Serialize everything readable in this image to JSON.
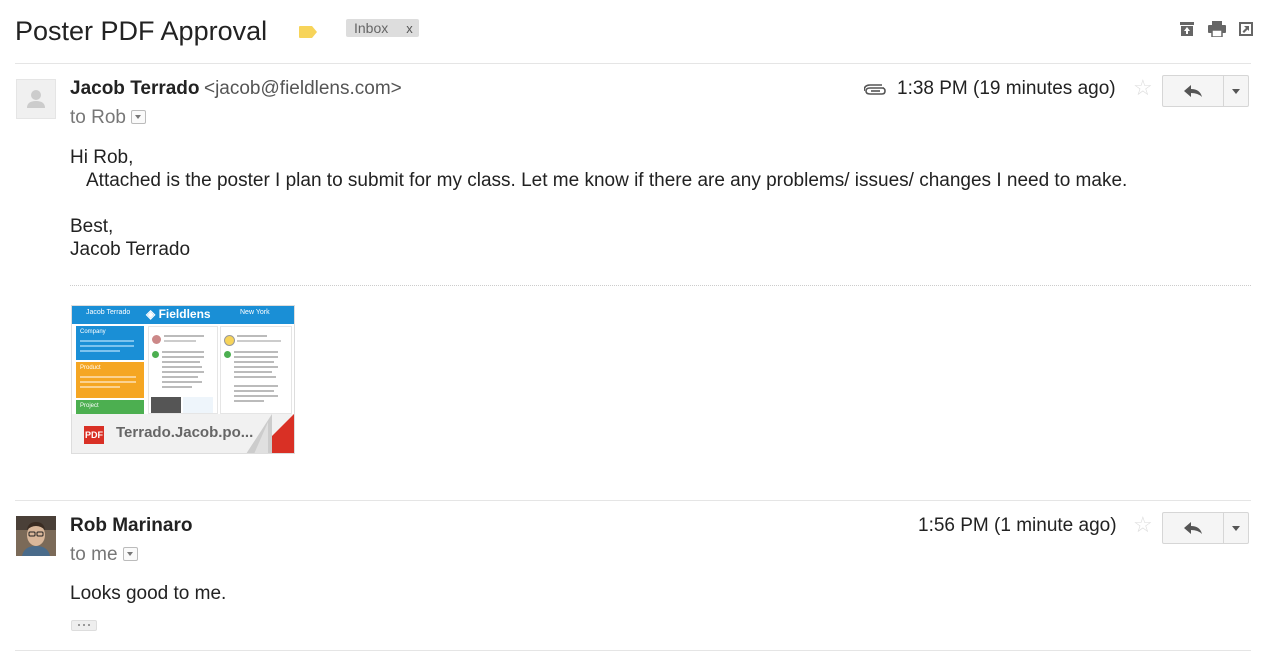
{
  "thread": {
    "subject": "Poster PDF Approval",
    "label": "Inbox",
    "label_remove": "x",
    "label_color": "#f7d45a"
  },
  "toolbar_icons": [
    "archive-icon",
    "print-icon",
    "new-window-icon"
  ],
  "messages": [
    {
      "sender_name": "Jacob Terrado",
      "sender_email": "<jacob@fieldlens.com>",
      "to_line": "to Rob",
      "time": "1:38 PM (19 minutes ago)",
      "has_attachment": true,
      "body_lines": [
        "Hi Rob,",
        "Attached is the poster I plan to submit for my class. Let me know if there are any problems/ issues/ changes I need to make.",
        "",
        "Best,",
        "Jacob Terrado"
      ],
      "attachment": {
        "type_label": "PDF",
        "filename": "Terrado.Jacob.po...",
        "preview": {
          "header_left": "Jacob Terrado",
          "header_brand": "Fieldlens",
          "header_right": "New York",
          "sections": [
            "Company",
            "Product",
            "Project"
          ]
        }
      }
    },
    {
      "sender_name": "Rob Marinaro",
      "to_line": "to me",
      "time": "1:56 PM (1 minute ago)",
      "has_attachment": false,
      "body_lines": [
        "Looks good to me."
      ]
    }
  ],
  "colors": {
    "accent_blue": "#1a8fd6",
    "pdf_red": "#d93025"
  }
}
